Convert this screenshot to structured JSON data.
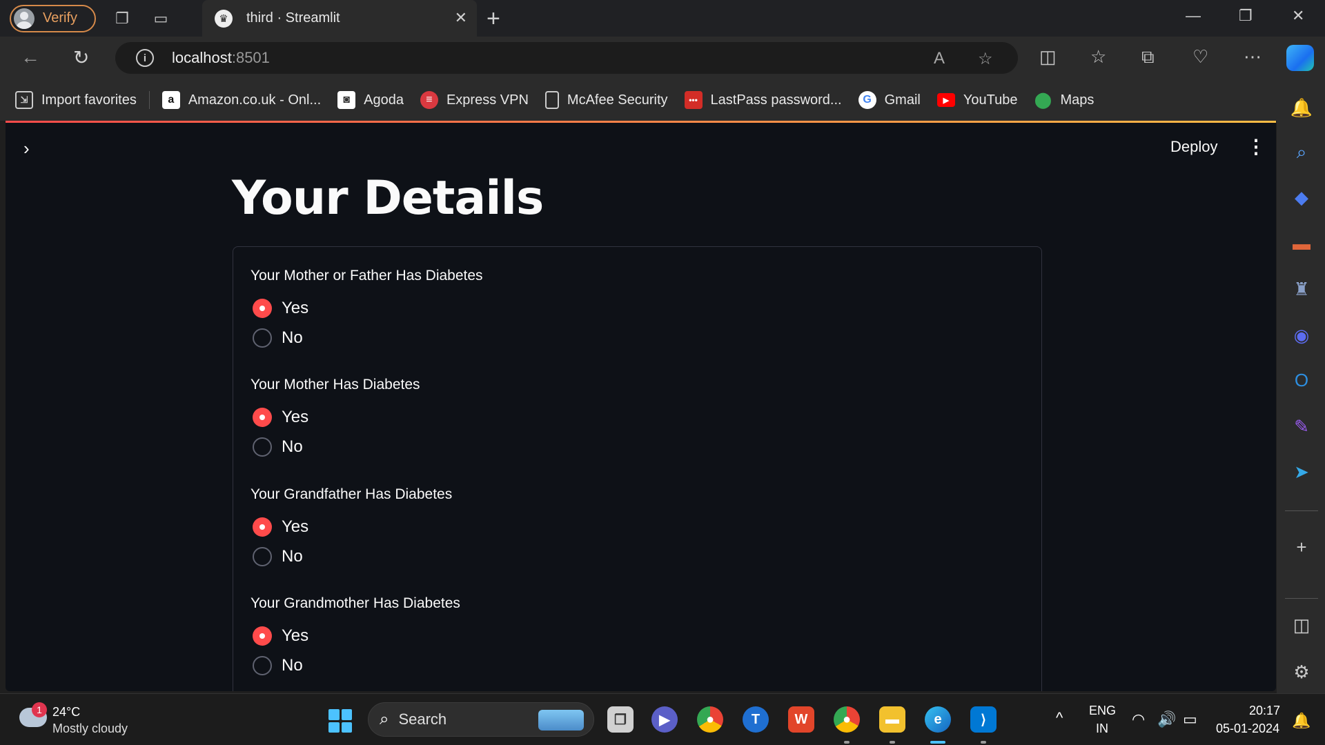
{
  "browser": {
    "profile_label": "Verify",
    "tab_title": "third · Streamlit",
    "url_host": "localhost",
    "url_port": ":8501"
  },
  "bookmarks": [
    {
      "label": "Import favorites",
      "icon": "import-favorites-icon"
    },
    {
      "label": "Amazon.co.uk - Onl...",
      "icon": "amazon-icon"
    },
    {
      "label": "Agoda",
      "icon": "agoda-icon"
    },
    {
      "label": "Express VPN",
      "icon": "expressvpn-icon"
    },
    {
      "label": "McAfee Security",
      "icon": "page-icon"
    },
    {
      "label": "LastPass password...",
      "icon": "lastpass-icon"
    },
    {
      "label": "Gmail",
      "icon": "google-icon"
    },
    {
      "label": "YouTube",
      "icon": "youtube-icon"
    },
    {
      "label": "Maps",
      "icon": "maps-pin-icon"
    }
  ],
  "app": {
    "deploy_label": "Deploy",
    "title": "Your Details",
    "questions": [
      {
        "label": "Your Mother or Father Has Diabetes",
        "options": [
          "Yes",
          "No"
        ],
        "selected": "Yes"
      },
      {
        "label": "Your Mother Has Diabetes",
        "options": [
          "Yes",
          "No"
        ],
        "selected": "Yes"
      },
      {
        "label": "Your Grandfather Has Diabetes",
        "options": [
          "Yes",
          "No"
        ],
        "selected": "Yes"
      },
      {
        "label": "Your Grandmother Has Diabetes",
        "options": [
          "Yes",
          "No"
        ],
        "selected": "Yes"
      }
    ]
  },
  "taskbar": {
    "weather_badge": "1",
    "weather_temp": "24°C",
    "weather_desc": "Mostly cloudy",
    "search_label": "Search",
    "lang_top": "ENG",
    "lang_bottom": "IN",
    "time": "20:17",
    "date": "05-01-2024"
  },
  "colors": {
    "accent": "#ff4b4b",
    "app_bg": "#0e1117",
    "browser_chrome": "#2b2b2b"
  }
}
